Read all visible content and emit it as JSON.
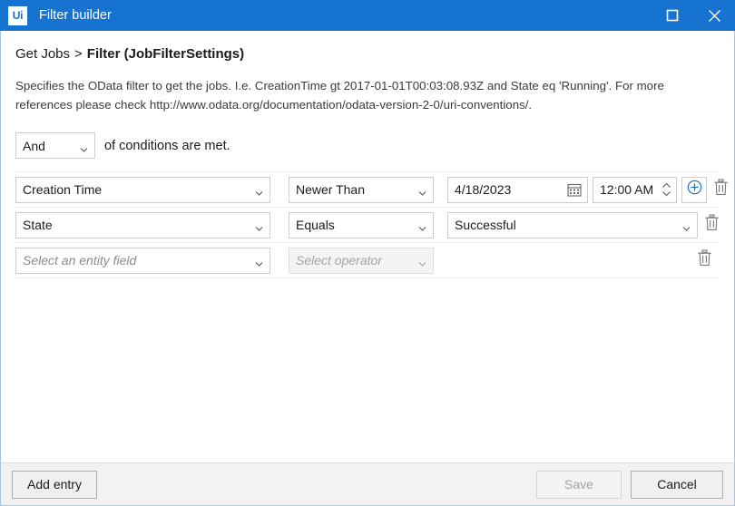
{
  "titlebar": {
    "logo_text": "Ui",
    "title": "Filter builder",
    "maximize_icon": "maximize-icon",
    "close_icon": "close-icon",
    "background_color": "#1673cf"
  },
  "breadcrumb": {
    "parent": "Get Jobs",
    "separator": ">",
    "current": "Filter (JobFilterSettings)"
  },
  "description": "Specifies the OData filter to get the jobs. I.e. CreationTime gt 2017-01-01T00:03:08.93Z and State eq 'Running'. For more references please check http://www.odata.org/documentation/odata-version-2-0/uri-conventions/.",
  "logic": {
    "operator": "And",
    "label": "of conditions are met."
  },
  "rows": [
    {
      "field": "Creation Time",
      "operator": "Newer Than",
      "value_type": "datetime",
      "date": "4/18/2023",
      "time": "12:00 AM",
      "has_add_button": true,
      "delete_icon": "trash-icon",
      "calendar_icon": "calendar-icon",
      "spinner_icon": "spinner-icon",
      "add_icon": "plus-circle-icon"
    },
    {
      "field": "State",
      "operator": "Equals",
      "value_type": "select",
      "value": "Successful",
      "has_add_button": false,
      "delete_icon": "trash-icon"
    },
    {
      "field": "Select an entity field",
      "field_is_placeholder": true,
      "operator": "Select operator",
      "operator_is_placeholder": true,
      "operator_disabled": true,
      "value_type": "none",
      "has_add_button": false,
      "delete_icon": "trash-icon"
    }
  ],
  "footer": {
    "add_entry": "Add entry",
    "save": "Save",
    "save_disabled": true,
    "cancel": "Cancel"
  },
  "colors": {
    "accent": "#1673cf",
    "border": "#cdcdcd",
    "window_border": "#a8c4e0",
    "footer_bg": "#f2f2f2"
  }
}
